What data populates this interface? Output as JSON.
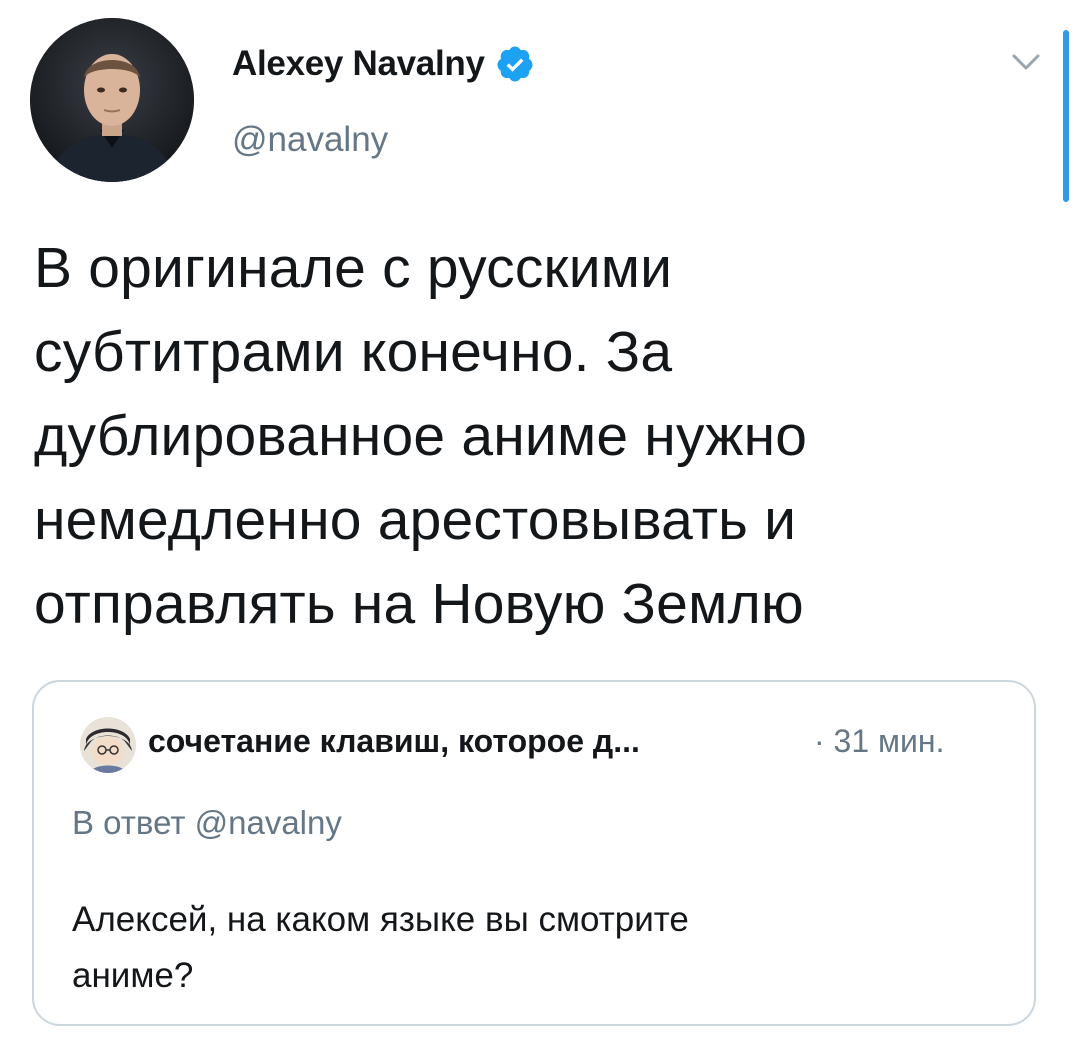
{
  "author": {
    "name": "Alexey Navalny",
    "handle": "@navalny",
    "verified": true
  },
  "tweet": {
    "lines": [
      "В оригинале с русскими",
      "субтитрами конечно. За",
      "дублированное аниме нужно",
      "немедленно арестовывать и",
      "отправлять на Новую Землю"
    ]
  },
  "quoted_tweet": {
    "author_name": "сочетание клавиш, которое д...",
    "time": "· 31 мин.",
    "reply_to": "В ответ @navalny",
    "lines": [
      "Алексей, на каком языке вы смотрите",
      "аниме?"
    ]
  },
  "icons": {
    "verified": "verified-badge-icon",
    "more": "chevron-down-icon"
  },
  "colors": {
    "verified_blue": "#1da1f2",
    "secondary_text": "#657786",
    "card_border": "#ccd6dd",
    "scroll_indicator": "#2f9ae9"
  }
}
